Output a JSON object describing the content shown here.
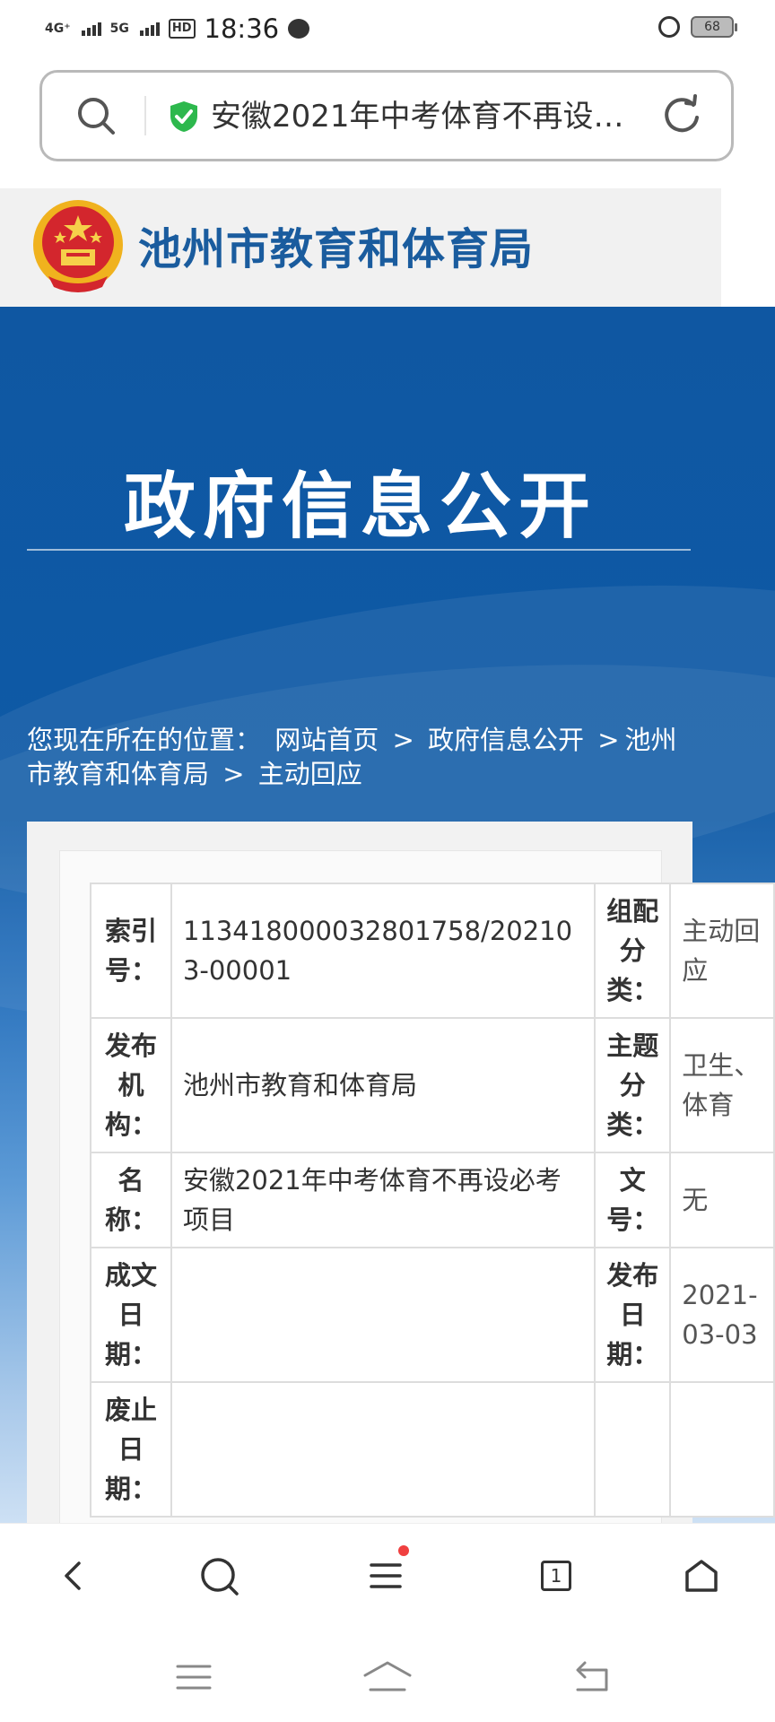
{
  "status_bar": {
    "network1": "4G⁺",
    "network2": "5G",
    "hd": "HD",
    "time": "18:36",
    "battery": "68"
  },
  "address_bar": {
    "title": "安徽2021年中考体育不再设…",
    "icons": [
      "search-icon",
      "shield-check-icon",
      "reload-icon"
    ]
  },
  "site": {
    "title": "池州市教育和体育局"
  },
  "banner": {
    "title": "政府信息公开"
  },
  "breadcrumb": {
    "prefix": "您现在所在的位置：",
    "items": [
      "网站首页",
      "政府信息公开",
      "池州市教育和体育局",
      "主动回应"
    ],
    "separator": ">"
  },
  "info_table": {
    "rows": [
      {
        "label": "索引号：",
        "value": "11341800003280175​8/202103-00001",
        "label2": "组配分类：",
        "value2": "主动回应"
      },
      {
        "label": "发布机构：",
        "value": "池州市教育和体育局",
        "label2": "主题分类：",
        "value2": "卫生、体育"
      },
      {
        "label": "名称：",
        "value": "安徽2021年中考体育不再设必考项目",
        "label2": "文号：",
        "value2": "无"
      },
      {
        "label": "成文日期：",
        "value": "",
        "label2": "发布日期：",
        "value2": "2021-03-03"
      },
      {
        "label": "废止日期：",
        "value": "",
        "label2": "",
        "value2": ""
      }
    ]
  },
  "toolbar": {
    "tab_count": "1",
    "icons": [
      "back-icon",
      "search-icon",
      "menu-icon",
      "tabs-icon",
      "home-icon"
    ]
  },
  "nav_bar": {
    "icons": [
      "recent-apps-icon",
      "home-icon",
      "back-icon"
    ]
  },
  "colors": {
    "brand_blue": "#1a5c9e",
    "banner_blue": "#0f57a2",
    "safe_green": "#2db84d",
    "notify_red": "#f04040"
  }
}
